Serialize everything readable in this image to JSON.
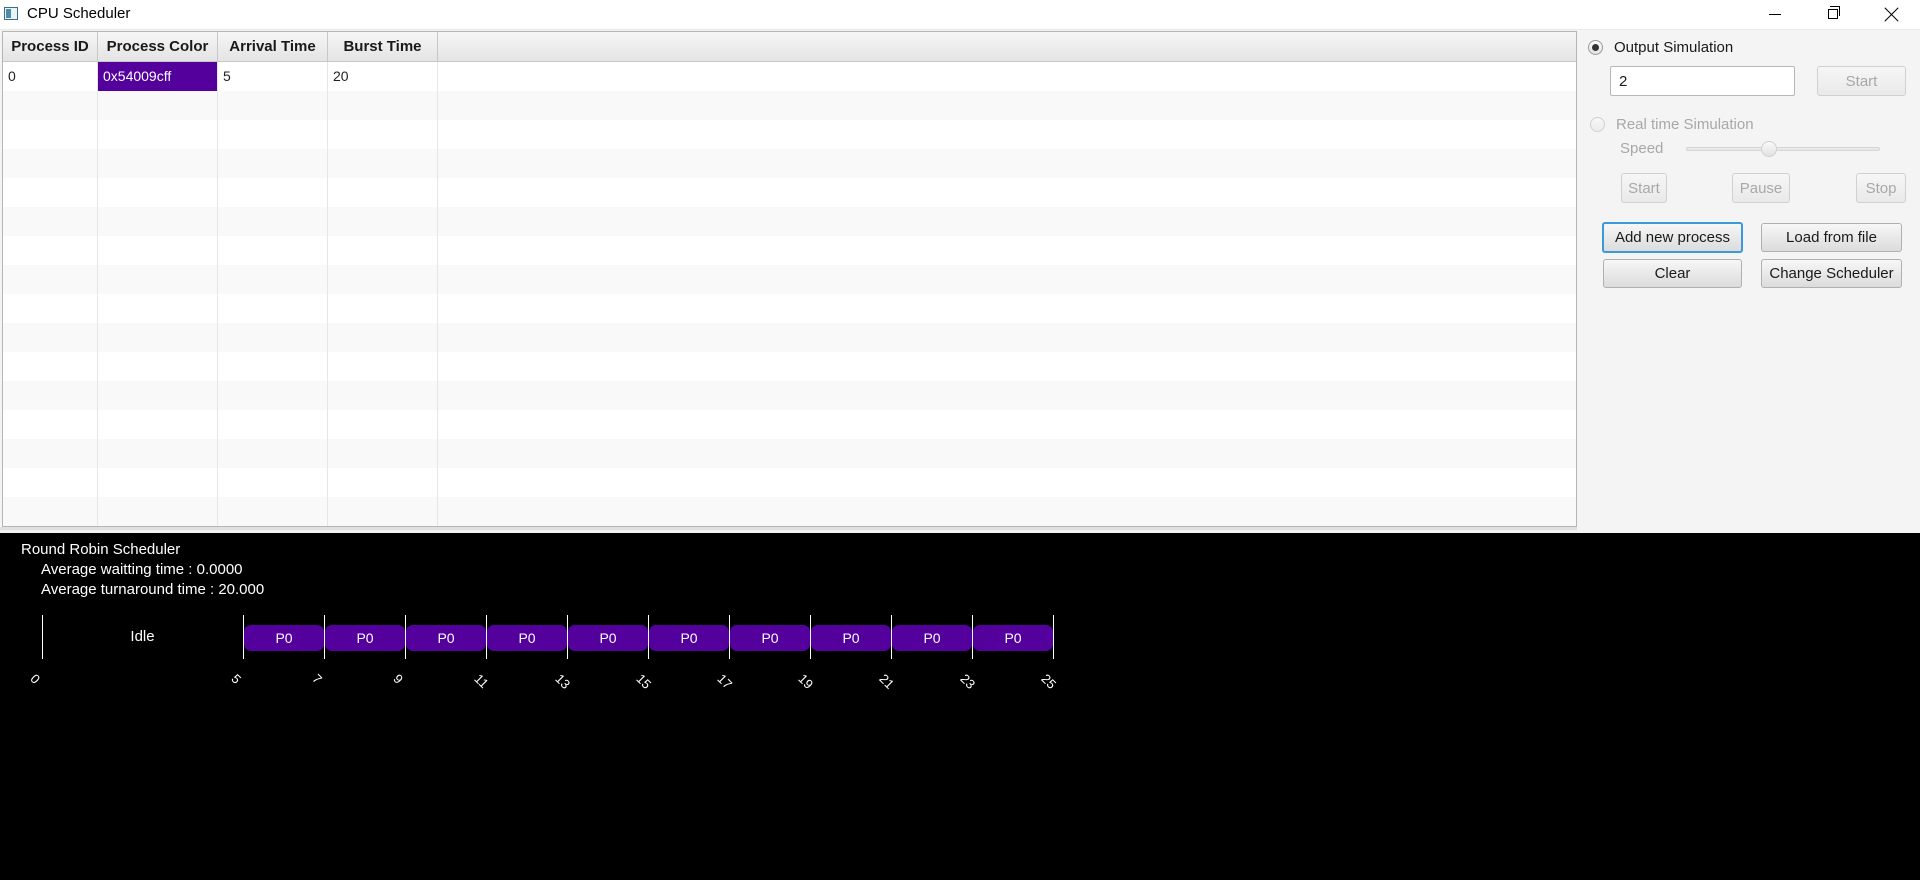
{
  "window": {
    "title": "CPU Scheduler"
  },
  "table": {
    "columns": [
      "Process ID",
      "Process Color",
      "Arrival Time",
      "Burst Time"
    ],
    "rows": [
      {
        "process_id": "0",
        "process_color": "0x54009cff",
        "arrival_time": "5",
        "burst_time": "20",
        "color_hex": "#54009c"
      }
    ]
  },
  "panel": {
    "output_simulation_label": "Output Simulation",
    "output_simulation_selected": true,
    "quantum_value": "2",
    "output_start_label": "Start",
    "realtime_simulation_label": "Real time Simulation",
    "speed_label": "Speed",
    "speed_value": 0.43,
    "rt_start_label": "Start",
    "rt_pause_label": "Pause",
    "rt_stop_label": "Stop",
    "add_process_label": "Add new process",
    "load_file_label": "Load from file",
    "clear_label": "Clear",
    "change_scheduler_label": "Change Scheduler"
  },
  "output": {
    "scheduler_name": "Round Robin Scheduler",
    "avg_waiting": "Average waitting time : 0.0000",
    "avg_turnaround": "Average turnaround time : 20.000",
    "gantt": {
      "idle_label": "Idle",
      "ticks": [
        "0",
        "5",
        "7",
        "9",
        "11",
        "13",
        "15",
        "17",
        "19",
        "21",
        "23",
        "25"
      ],
      "segments": [
        {
          "label": "Idle",
          "start": 0,
          "end": 5,
          "idle": true
        },
        {
          "label": "P0",
          "start": 5,
          "end": 7
        },
        {
          "label": "P0",
          "start": 7,
          "end": 9
        },
        {
          "label": "P0",
          "start": 9,
          "end": 11
        },
        {
          "label": "P0",
          "start": 11,
          "end": 13
        },
        {
          "label": "P0",
          "start": 13,
          "end": 15
        },
        {
          "label": "P0",
          "start": 15,
          "end": 17
        },
        {
          "label": "P0",
          "start": 17,
          "end": 19
        },
        {
          "label": "P0",
          "start": 19,
          "end": 21
        },
        {
          "label": "P0",
          "start": 21,
          "end": 23
        },
        {
          "label": "P0",
          "start": 23,
          "end": 25
        }
      ],
      "block_color": "#54009c"
    }
  }
}
